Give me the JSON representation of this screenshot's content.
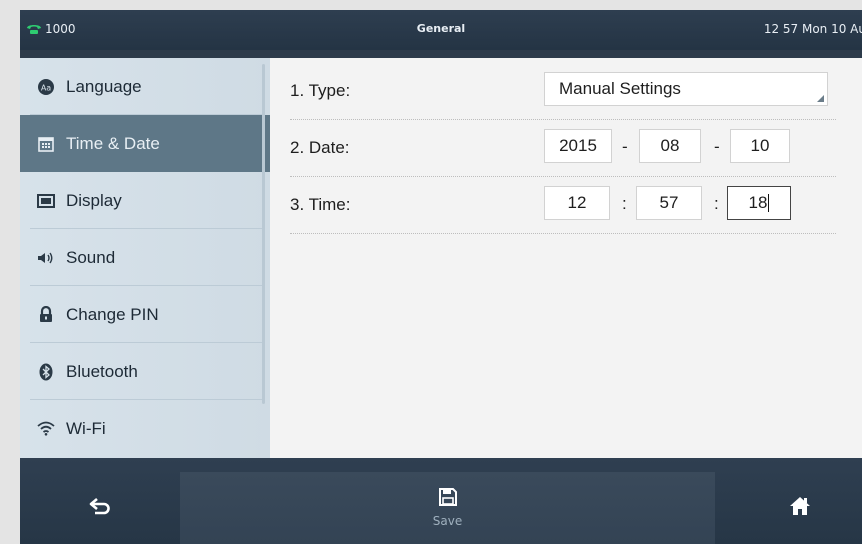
{
  "status_bar": {
    "account": "1000",
    "title": "General",
    "datetime": "12 57 Mon 10 Au"
  },
  "sidebar": {
    "items": [
      {
        "label": "Language",
        "icon": "language-icon"
      },
      {
        "label": "Time & Date",
        "icon": "calendar-icon",
        "active": true
      },
      {
        "label": "Display",
        "icon": "display-icon"
      },
      {
        "label": "Sound",
        "icon": "speaker-icon"
      },
      {
        "label": "Change PIN",
        "icon": "lock-icon"
      },
      {
        "label": "Bluetooth",
        "icon": "bluetooth-icon"
      },
      {
        "label": "Wi-Fi",
        "icon": "wifi-icon"
      }
    ]
  },
  "form": {
    "type": {
      "label": "1. Type:",
      "value": "Manual Settings"
    },
    "date": {
      "label": "2. Date:",
      "year": "2015",
      "month": "08",
      "day": "10",
      "separator": "-"
    },
    "time": {
      "label": "3. Time:",
      "hour": "12",
      "minute": "57",
      "second": "18",
      "separator": ":"
    }
  },
  "softkeys": {
    "back_icon": "back-arrow-icon",
    "save_label": "Save",
    "save_icon": "save-icon",
    "home_icon": "home-icon"
  },
  "colors": {
    "active_item_bg": "#5e7787",
    "sidebar_bg": "#d7e2ea",
    "bar_bg": "#2d3b4a",
    "phone_icon": "#2ecc71"
  }
}
